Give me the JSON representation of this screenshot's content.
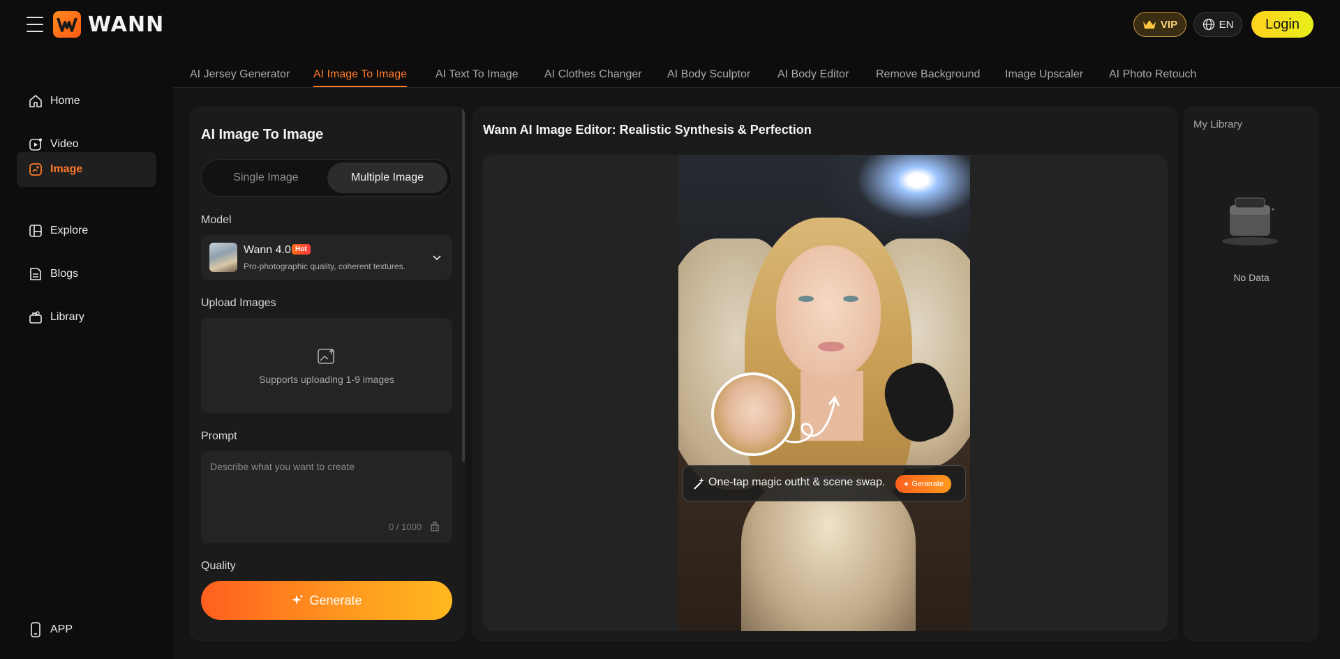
{
  "header": {
    "brand": "WANN",
    "vip_label": "VIP",
    "lang_label": "EN",
    "login_label": "Login"
  },
  "sidebar": {
    "items": [
      {
        "label": "Home",
        "icon": "home-icon"
      },
      {
        "label": "Video",
        "icon": "video-icon"
      },
      {
        "label": "Image",
        "icon": "image-icon",
        "active": true
      },
      {
        "label": "Explore",
        "icon": "explore-icon"
      },
      {
        "label": "Blogs",
        "icon": "blogs-icon"
      },
      {
        "label": "Library",
        "icon": "library-icon"
      }
    ],
    "app_label": "APP"
  },
  "tabs": [
    {
      "label": "AI Jersey Generator"
    },
    {
      "label": "AI Image To Image",
      "active": true
    },
    {
      "label": "AI Text To Image"
    },
    {
      "label": "AI Clothes Changer"
    },
    {
      "label": "AI Body Sculptor"
    },
    {
      "label": "AI Body Editor"
    },
    {
      "label": "Remove Background"
    },
    {
      "label": "Image Upscaler"
    },
    {
      "label": "AI Photo Retouch"
    }
  ],
  "left_panel": {
    "title": "AI Image To Image",
    "segment": {
      "single": "Single Image",
      "multiple": "Multiple Image",
      "selected": "Multiple Image"
    },
    "model_label": "Model",
    "model": {
      "name": "Wann 4.0",
      "badge": "Hot",
      "description": "Pro-photographic quality, coherent textures."
    },
    "upload_label": "Upload Images",
    "upload_hint": "Supports uploading 1-9 images",
    "prompt_label": "Prompt",
    "prompt_placeholder": "Describe what you want to create",
    "prompt_counter": "0 / 1000",
    "quality_label": "Quality",
    "generate_label": "Generate"
  },
  "center_panel": {
    "title": "Wann AI Image Editor: Realistic Synthesis & Perfection",
    "overlay_text": "One-tap magic outht & scene swap.",
    "overlay_button": "Generate"
  },
  "right_panel": {
    "title": "My Library",
    "empty_text": "No Data"
  },
  "colors": {
    "accent": "#ff7a2a",
    "login": "#ffd21e",
    "vip": "#ffd37a"
  }
}
